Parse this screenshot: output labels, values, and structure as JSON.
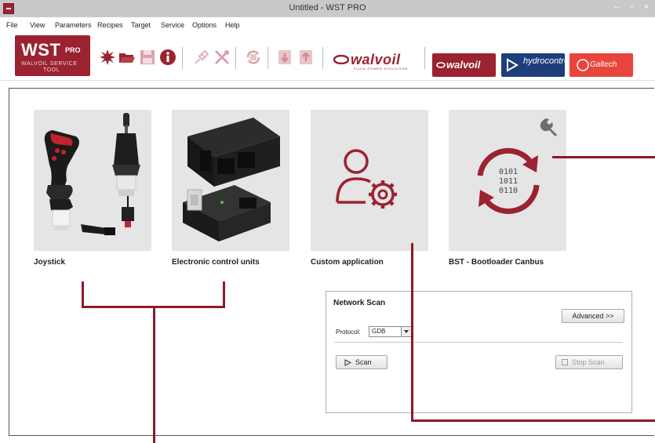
{
  "window": {
    "title": "Untitled - WST PRO",
    "controls": [
      "–",
      "▫",
      "×"
    ]
  },
  "menu": [
    "File",
    "View",
    "Parameters",
    "Recipes",
    "Target",
    "Service",
    "Options",
    "Help"
  ],
  "logo": {
    "main": "WST",
    "pro": "PRO",
    "sub1": "WALVOIL SERVICE",
    "sub2": "TOOL"
  },
  "toolbar_icons": [
    "new-icon",
    "open-folder-icon",
    "save-icon",
    "info-icon",
    "connect-icon",
    "tools-icon",
    "refresh-icon",
    "download-icon",
    "upload-icon"
  ],
  "brands": {
    "walvoil_plain": "walvoil",
    "walvoil_tag": "FLUID POWER EVOLUTION",
    "walvoil_badge": "walvoil",
    "hydro": "hydrocontrol",
    "galtech": "Galtech"
  },
  "tiles": [
    {
      "label": "Joystick"
    },
    {
      "label": "Electronic control units"
    },
    {
      "label": "Custom application"
    },
    {
      "label": "BST - Bootloader Canbus"
    }
  ],
  "bst_code": [
    "0101",
    "1011",
    "0110"
  ],
  "network_scan": {
    "title": "Network Scan",
    "advanced": "Advanced >>",
    "protocol_label": "Protocol:",
    "protocol_value": "GDB",
    "scan": "Scan",
    "stop_scan": "Stop Scan"
  },
  "colors": {
    "brand_red": "#9b2230",
    "callout": "#8b1a28",
    "hydro_blue": "#1e3e7a",
    "galtech_red": "#e8453c"
  }
}
